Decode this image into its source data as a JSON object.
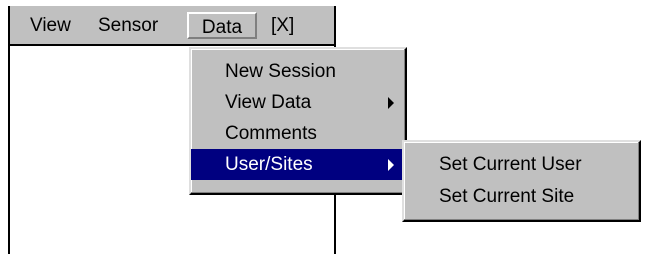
{
  "menubar": {
    "items": [
      "View",
      "Sensor",
      "Data",
      "[X]"
    ]
  },
  "data_menu": {
    "items": [
      {
        "label": "New Session",
        "submenu": false,
        "selected": false
      },
      {
        "label": "View Data",
        "submenu": true,
        "selected": false
      },
      {
        "label": "Comments",
        "submenu": false,
        "selected": false
      },
      {
        "label": "User/Sites",
        "submenu": true,
        "selected": true
      }
    ]
  },
  "user_sites_menu": {
    "items": [
      {
        "label": "Set Current User"
      },
      {
        "label": "Set Current Site"
      }
    ]
  },
  "colors": {
    "menu_bg": "#c0c0c0",
    "highlight": "#000080",
    "highlight_text": "#ffffff"
  }
}
